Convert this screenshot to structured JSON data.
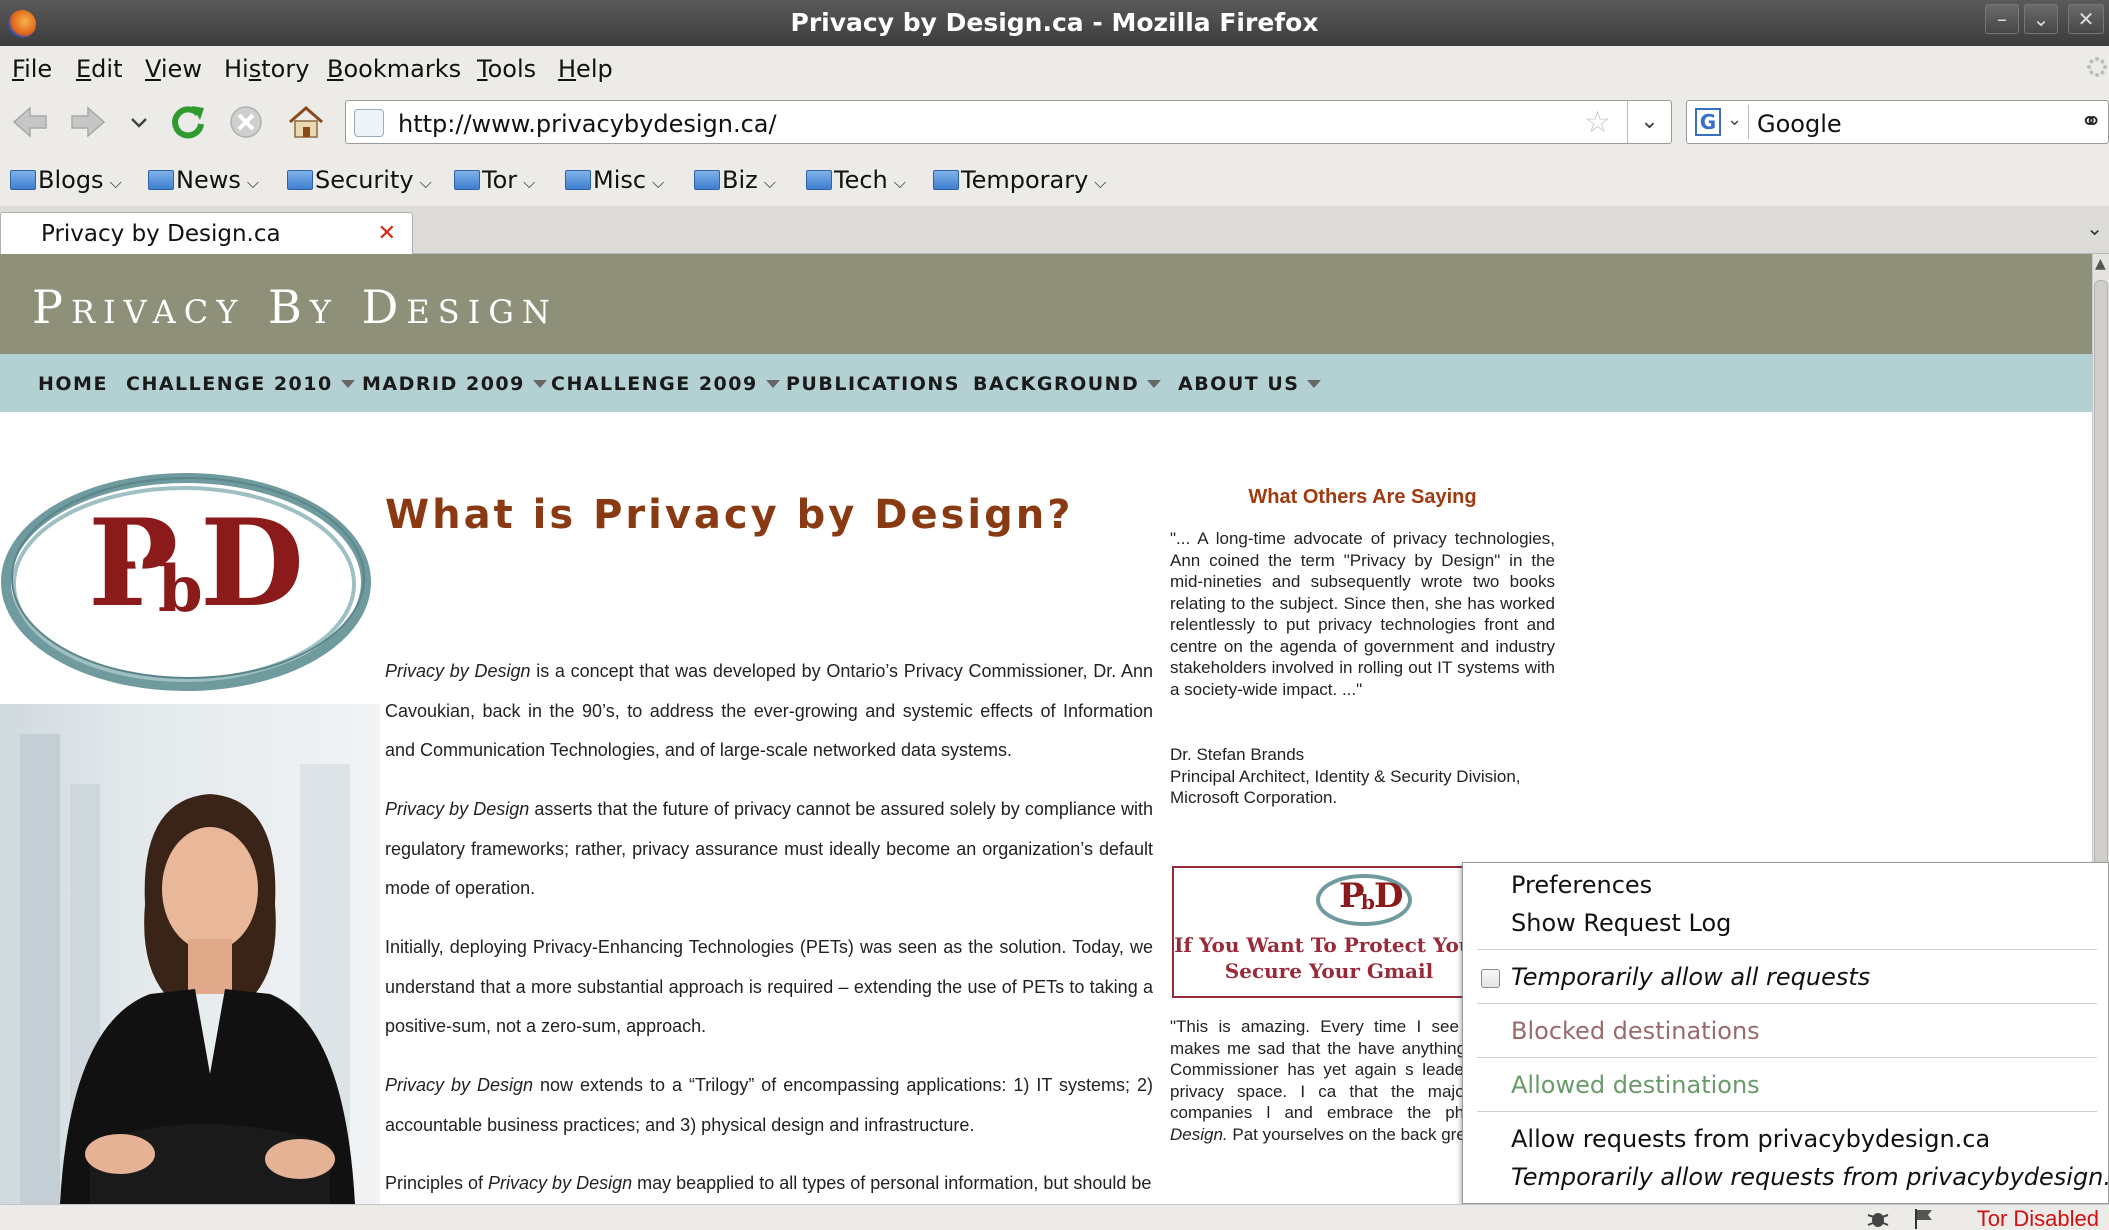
{
  "window": {
    "title": "Privacy by Design.ca - Mozilla Firefox"
  },
  "menubar": [
    {
      "label": "File",
      "key": "F",
      "rest": "ile"
    },
    {
      "label": "Edit",
      "key": "E",
      "rest": "dit"
    },
    {
      "label": "View",
      "key": "V",
      "rest": "iew"
    },
    {
      "label": "History",
      "key": "",
      "pre": "Hi",
      "mid": "s",
      "post": "tory"
    },
    {
      "label": "Bookmarks",
      "key": "B",
      "rest": "ookmarks"
    },
    {
      "label": "Tools",
      "key": "T",
      "rest": "ools"
    },
    {
      "label": "Help",
      "key": "H",
      "rest": "elp"
    }
  ],
  "navbar": {
    "url": "http://www.privacybydesign.ca/",
    "search_value": "Google",
    "search_engine_letter": "G"
  },
  "bookmarks": [
    "Blogs",
    "News",
    "Security",
    "Tor",
    "Misc",
    "Biz",
    "Tech",
    "Temporary"
  ],
  "tab": {
    "label": "Privacy by Design.ca"
  },
  "site": {
    "title": "Privacy By Design",
    "nav": [
      {
        "label": "HOME",
        "dropdown": false
      },
      {
        "label": "CHALLENGE 2010",
        "dropdown": true
      },
      {
        "label": "MADRID 2009",
        "dropdown": true
      },
      {
        "label": "CHALLENGE 2009",
        "dropdown": true
      },
      {
        "label": "PUBLICATIONS",
        "dropdown": false
      },
      {
        "label": "BACKGROUND",
        "dropdown": true
      },
      {
        "label": "ABOUT US",
        "dropdown": true
      }
    ],
    "logo_text": {
      "p": "P",
      "b": "b",
      "d": "D"
    },
    "heading": "What is Privacy by Design?",
    "p1": {
      "em": "Privacy by Design",
      "text": " is a concept that was developed by Ontario’s Privacy Commissioner, Dr. Ann Cavoukian, back in the 90’s, to address the ever-growing and systemic effects of Information and Communication Technologies, and of large-scale networked data systems."
    },
    "p2": {
      "em": "Privacy by Design",
      "text": " asserts that the future of privacy cannot be assured solely by compliance with regulatory frameworks; rather, privacy assurance must ideally become an organization’s default mode of operation."
    },
    "p3": {
      "text": "Initially, deploying Privacy-Enhancing Technologies (PETs) was seen as the solution. Today, we understand that a more substantial approach is required – extending the use of PETs to taking a positive-sum, not a zero-sum, approach."
    },
    "p4": {
      "em": "Privacy by Design",
      "text": " now extends to a “Trilogy” of encompassing applications: 1) IT systems; 2) accountable business practices; and 3) physical design and infrastructure."
    },
    "p5": {
      "pre": "Principles of ",
      "em": "Privacy by Design",
      "text": " may beapplied to all types of personal information, but should be"
    },
    "side_heading": "What Others Are Saying",
    "quote1": "\"... A long-time advocate of privacy technologies, Ann coined the term \"Privacy by Design\" in the mid-nineties and subsequently wrote two books relating to the subject. Since then, she has worked relentlessly to put privacy technologies front and centre on the agenda of government and industry stakeholders involved in rolling out IT systems with a society-wide impact. ...\"",
    "quote1_author": "Dr. Stefan Brands",
    "quote1_role": "Principal Architect, Identity & Security Division,",
    "quote1_org": "Microsoft Corporation.",
    "ad_text": "If You Want To Protect Your Secure Your Gmail",
    "quote2": "\"This is amazing. Every time I see like this, it makes me sad that the have anything like your o Commissioner has yet again s leadership in the privacy space. I ca that the major Web 2.0 companies l and embrace the philosophy of",
    "quote2_em": "Design.",
    "quote2_tail": " Pat yourselves on the back great job.\""
  },
  "context_menu": {
    "preferences": "Preferences",
    "request_log": "Show Request Log",
    "allow_all": "Temporarily allow all requests",
    "blocked": "Blocked destinations",
    "allowed": "Allowed destinations",
    "allow_site": "Allow requests from privacybydesign.ca",
    "temp_allow_site": "Temporarily allow requests from privacybydesign.ca",
    "colors": {
      "blocked": "#9a6a6a",
      "allowed": "#6a9a6a"
    }
  },
  "statusbar": {
    "tor": "Tor Disabled"
  }
}
